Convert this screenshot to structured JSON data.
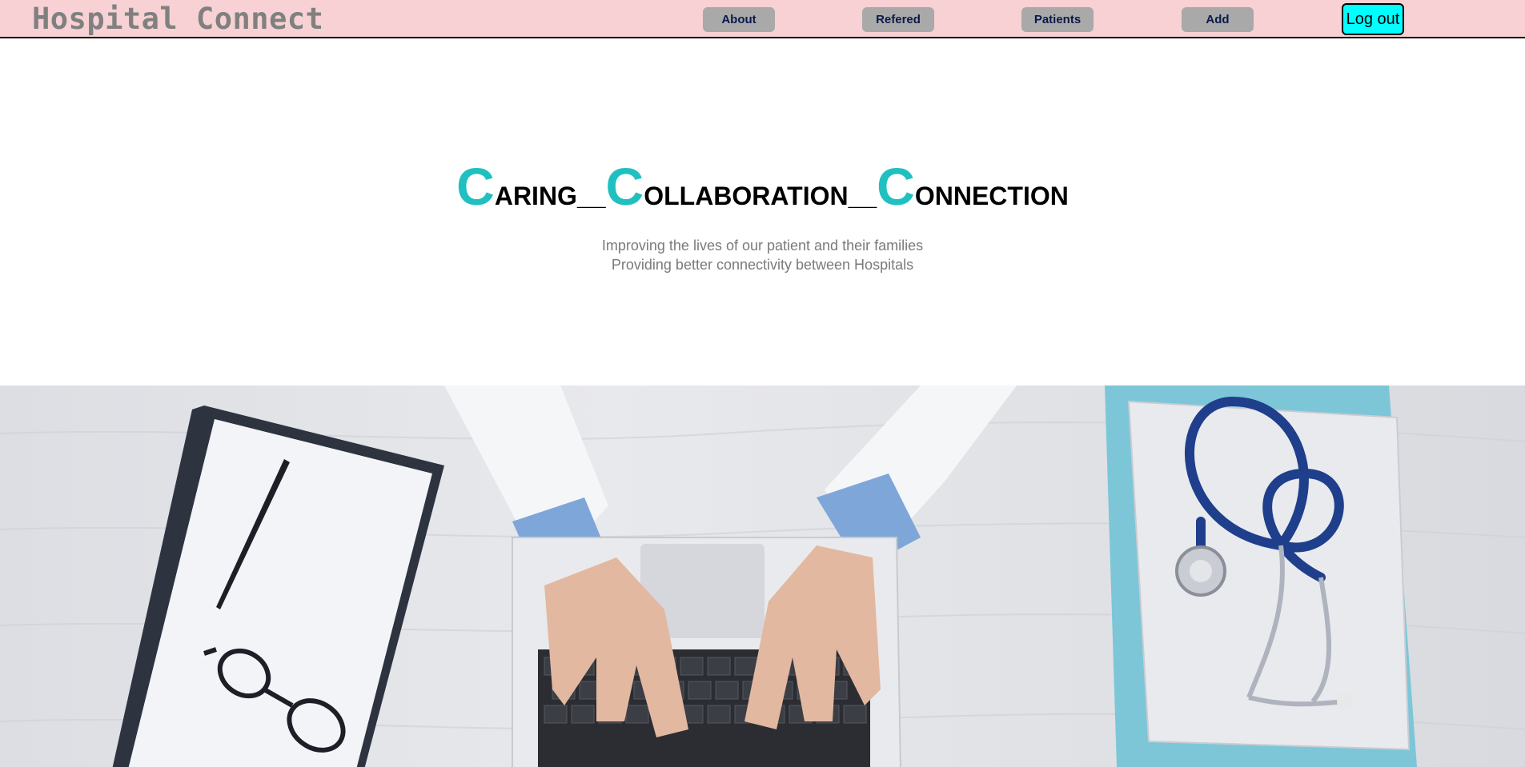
{
  "brand": "Hospital Connect",
  "nav": {
    "about": "About",
    "refered": "Refered",
    "patients": "Patients",
    "add": "Add",
    "logout": "Log out"
  },
  "hero": {
    "words": [
      {
        "initial": "C",
        "rest": "ARING",
        "sep": "__"
      },
      {
        "initial": "C",
        "rest": "OLLABORATION",
        "sep": "__"
      },
      {
        "initial": "C",
        "rest": "ONNECTION",
        "sep": ""
      }
    ],
    "tagline_1": "Improving the lives of our patient and their families",
    "tagline_2": "Providing better connectivity between Hospitals"
  },
  "colors": {
    "navbar_bg": "#f7d1d3",
    "accent": "#20c0c0",
    "logout_bg": "#00ffff",
    "nav_button_bg": "#a9a9a9"
  }
}
